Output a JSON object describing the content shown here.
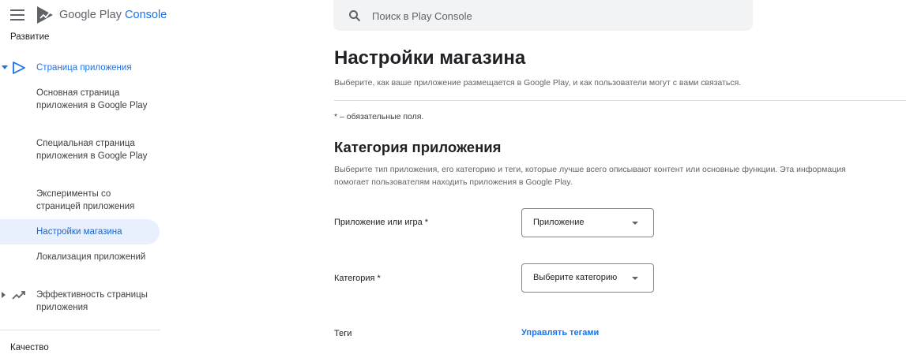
{
  "app": {
    "brand_google": "Google",
    "brand_play": " Play",
    "brand_console": " Console"
  },
  "search": {
    "placeholder": "Поиск в Play Console",
    "icon": "search-icon"
  },
  "sidebar": {
    "section_top": "Развитие",
    "items": [
      {
        "label": "Страница приложения",
        "icon": "play-arrow-icon",
        "state": "expanded-parent"
      },
      {
        "label": "Основная страница приложения в Google Play"
      },
      {
        "label": "Специальная страница приложения в Google Play"
      },
      {
        "label": "Эксперименты со страницей приложения"
      },
      {
        "label": "Настройки магазина",
        "state": "selected"
      },
      {
        "label": "Локализация приложений"
      },
      {
        "label": "Эффективность страницы приложения",
        "icon": "trending-up-icon"
      }
    ],
    "section_bottom": "Качество"
  },
  "main": {
    "title": "Настройки магазина",
    "subtitle": "Выберите, как ваше приложение размещается в Google Play, и как пользователи могут с вами связаться.",
    "required_note": "* – обязательные поля.",
    "category_section": {
      "title": "Категория приложения",
      "description": "Выберите тип приложения, его категорию и теги, которые лучше всего описывают контент или основные функции. Эта информация помогает пользователям находить приложения в Google Play.",
      "fields": [
        {
          "label": "Приложение или игра  *",
          "value": "Приложение"
        },
        {
          "label": "Категория  *",
          "value": "Выберите категорию"
        }
      ],
      "tags_label": "Теги",
      "tags_link": "Управлять тегами"
    }
  },
  "colors": {
    "accent": "#1a73e8",
    "selected_bg": "#e8f0fe",
    "search_bg": "#f1f3f4"
  }
}
